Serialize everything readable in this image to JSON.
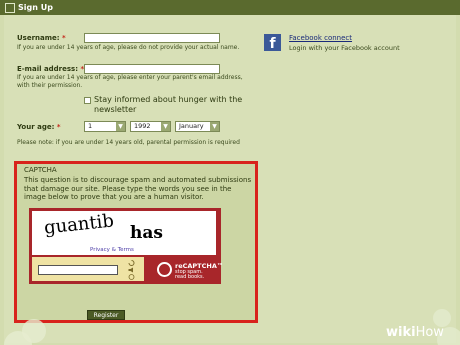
{
  "window": {
    "title": "Sign Up"
  },
  "form": {
    "username": {
      "label": "Username:",
      "required": "*",
      "value": "",
      "help": "If you are under 14 years of age, please do not provide your actual name."
    },
    "email": {
      "label": "E-mail address:",
      "required": "*",
      "value": "",
      "help": "If you are under 14 years of age, please enter your parent's email address, with their permission."
    },
    "newsletter": {
      "label": "Stay informed about hunger with the newsletter",
      "checked": false
    },
    "age": {
      "label": "Your age:",
      "required": "*",
      "day": "1",
      "year": "1992",
      "month": "January",
      "note": "Please note: if you are under 14 years old, parental permission is required"
    }
  },
  "facebook": {
    "icon": "facebook-icon",
    "link": "Facebook connect",
    "desc": "Login with your Facebook account"
  },
  "captcha": {
    "heading": "CAPTCHA",
    "text": "This question is to discourage spam and automated submissions that damage our site. Please type the words you see in the image below to prove that you are a human visitor.",
    "word1": "guantib",
    "word2": "has",
    "privacy": "Privacy & Terms",
    "input_value": "",
    "brand": "reCAPTCHA™",
    "tagline": "stop spam. read books."
  },
  "register_button": "Register",
  "watermark": {
    "wiki": "wiki",
    "how": "How"
  },
  "colors": {
    "titlebar": "#5a6a2e",
    "background": "#d3dcaf",
    "highlight": "#d8231c",
    "captcha_widget": "#a8262a",
    "facebook": "#3b5998"
  }
}
